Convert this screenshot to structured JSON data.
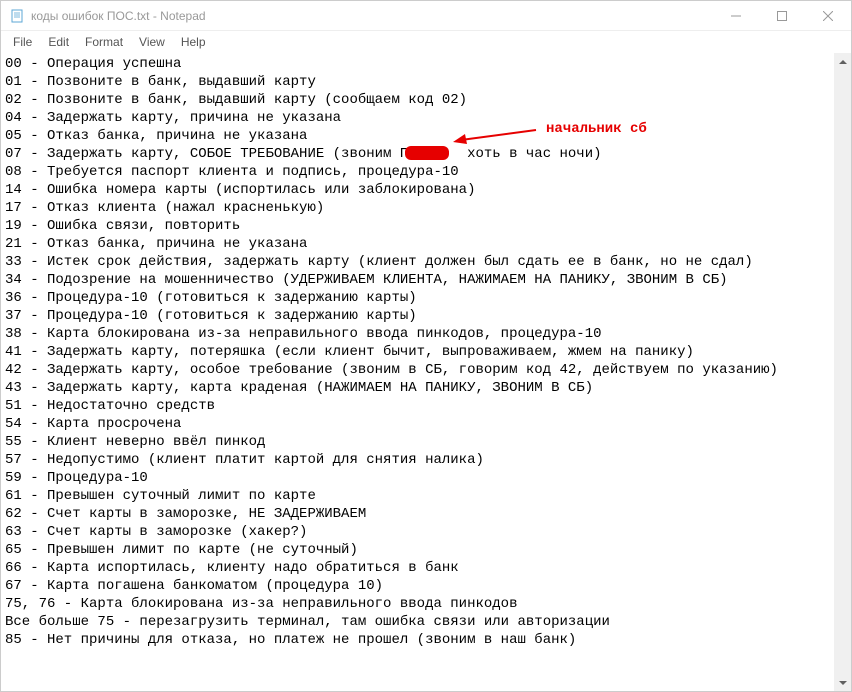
{
  "window": {
    "title": "коды ошибок ПОС.txt - Notepad"
  },
  "menu": {
    "file": "File",
    "edit": "Edit",
    "format": "Format",
    "view": "View",
    "help": "Help"
  },
  "annotation": {
    "label": "начальник сб"
  },
  "lines": [
    "00 - Операция успешна",
    "01 - Позвоните в банк, выдавший карту",
    "02 - Позвоните в банк, выдавший карту (сообщаем код 02)",
    "04 - Задержать карту, причина не указана",
    "05 - Отказ банка, причина не указана",
    "07 - Задержать карту, СОБОЕ ТРЕБОВАНИЕ (звоним П       хоть в час ночи)",
    "08 - Требуется паспорт клиента и подпись, процедура-10",
    "14 - Ошибка номера карты (испортилась или заблокирована)",
    "17 - Отказ клиента (нажал красненькую)",
    "19 - Ошибка связи, повторить",
    "21 - Отказ банка, причина не указана",
    "33 - Истек срок действия, задержать карту (клиент должен был сдать ее в банк, но не сдал)",
    "34 - Подозрение на мошенничество (УДЕРЖИВАЕМ КЛИЕНТА, НАЖИМАЕМ НА ПАНИКУ, ЗВОНИМ В СБ)",
    "36 - Процедура-10 (готовиться к задержанию карты)",
    "37 - Процедура-10 (готовиться к задержанию карты)",
    "38 - Карта блокирована из-за неправильного ввода пинкодов, процедура-10",
    "41 - Задержать карту, потеряшка (если клиент бычит, выпроваживаем, жмем на панику)",
    "42 - Задержать карту, особое требование (звоним в СБ, говорим код 42, действуем по указанию)",
    "43 - Задержать карту, карта краденая (НАЖИМАЕМ НА ПАНИКУ, ЗВОНИМ В СБ)",
    "51 - Недостаточно средств",
    "54 - Карта просрочена",
    "55 - Клиент неверно ввёл пинкод",
    "57 - Недопустимо (клиент платит картой для снятия налика)",
    "59 - Процедура-10",
    "61 - Превышен суточный лимит по карте",
    "62 - Счет карты в заморозке, НЕ ЗАДЕРЖИВАЕМ",
    "63 - Счет карты в заморозке (хакер?)",
    "65 - Превышен лимит по карте (не суточный)",
    "66 - Карта испортилась, клиенту надо обратиться в банк",
    "67 - Карта погашена банкоматом (процедура 10)",
    "75, 76 - Карта блокирована из-за неправильного ввода пинкодов",
    "Все больше 75 - перезагрузить терминал, там ошибка связи или авторизации",
    "85 - Нет причины для отказа, но платеж не прошел (звоним в наш банк)"
  ]
}
